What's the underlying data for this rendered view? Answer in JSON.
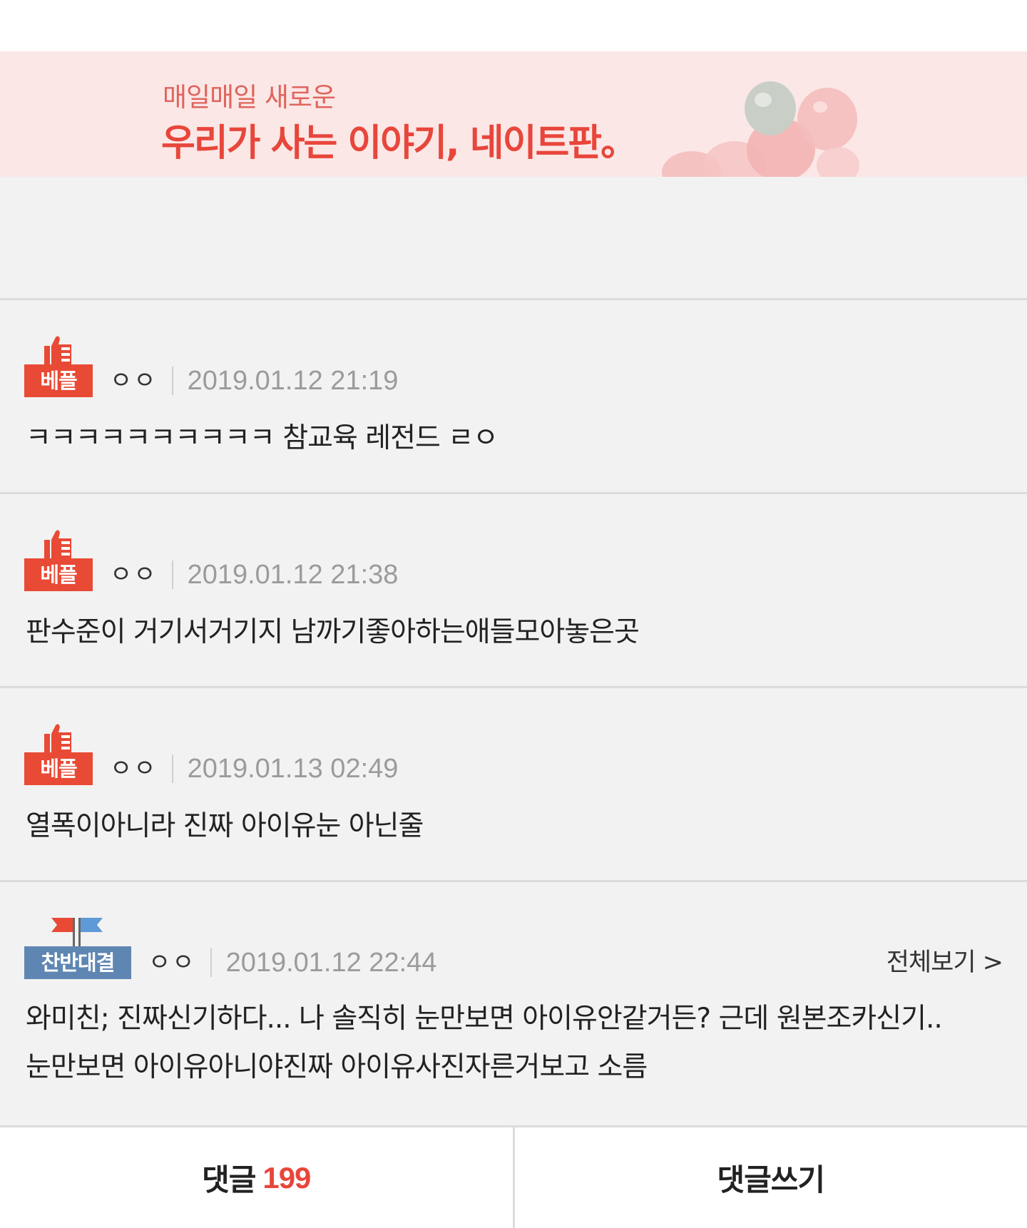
{
  "banner": {
    "subtitle": "매일매일 새로운",
    "title": "우리가 사는 이야기, 네이트판。"
  },
  "comments": [
    {
      "badge": "베플",
      "author": "ㅇㅇ",
      "date": "2019.01.12 21:19",
      "text": "ㅋㅋㅋㅋㅋㅋㅋㅋㅋㅋ 참교육 레전드 ㄹㅇ"
    },
    {
      "badge": "베플",
      "author": "ㅇㅇ",
      "date": "2019.01.12 21:38",
      "text": "판수준이 거기서거기지 남까기좋아하는애들모아놓은곳"
    },
    {
      "badge": "베플",
      "author": "ㅇㅇ",
      "date": "2019.01.13 02:49",
      "text": "열폭이아니라 진짜 아이유눈 아닌줄"
    },
    {
      "badge": "찬반대결",
      "author": "ㅇㅇ",
      "date": "2019.01.12 22:44",
      "view_all": "전체보기 >",
      "text_line1": "와미친; 진짜신기하다... 나 솔직히 눈만보면 아이유안같거든? 근데 원본조카신기..",
      "text_line2": "눈만보면 아이유아니야진짜 아이유사진자른거보고 소름"
    }
  ],
  "bottom_bar": {
    "comments_label": "댓글",
    "comments_count": "199",
    "write_label": "댓글쓰기"
  },
  "colors": {
    "accent": "#e8463b",
    "banner_bg": "#fbe7e6",
    "debate_badge": "#5f86b3"
  }
}
